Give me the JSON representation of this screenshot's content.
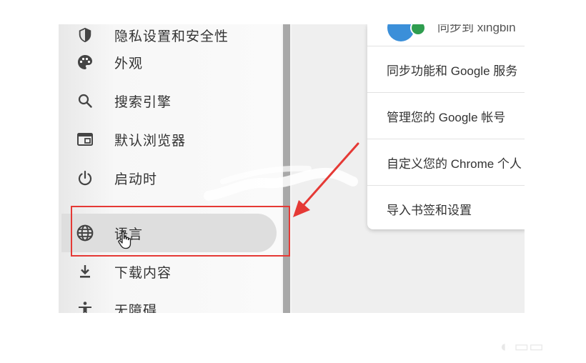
{
  "sidebar": {
    "items": [
      {
        "label": "隐私设置和安全性",
        "icon": "shield-icon"
      },
      {
        "label": "外观",
        "icon": "palette-icon"
      },
      {
        "label": "搜索引擎",
        "icon": "search-icon"
      },
      {
        "label": "默认浏览器",
        "icon": "browser-window-icon"
      },
      {
        "label": "启动时",
        "icon": "power-icon"
      },
      {
        "label": "语言",
        "icon": "globe-icon",
        "active": true
      },
      {
        "label": "下载内容",
        "icon": "download-icon"
      },
      {
        "label": "无障碍",
        "icon": "accessibility-icon"
      }
    ]
  },
  "card": {
    "profile_text": "同步到 xingbin",
    "rows": [
      {
        "label": "同步功能和 Google 服务"
      },
      {
        "label": "管理您的 Google 帐号"
      },
      {
        "label": "自定义您的 Chrome 个人"
      },
      {
        "label": "导入书签和设置"
      }
    ]
  },
  "colors": {
    "highlight": "#e53935",
    "active_item_bg": "#dedede",
    "text": "#333333",
    "avatar_blue": "#3b8fd9",
    "avatar_green": "#2e9d4f"
  }
}
